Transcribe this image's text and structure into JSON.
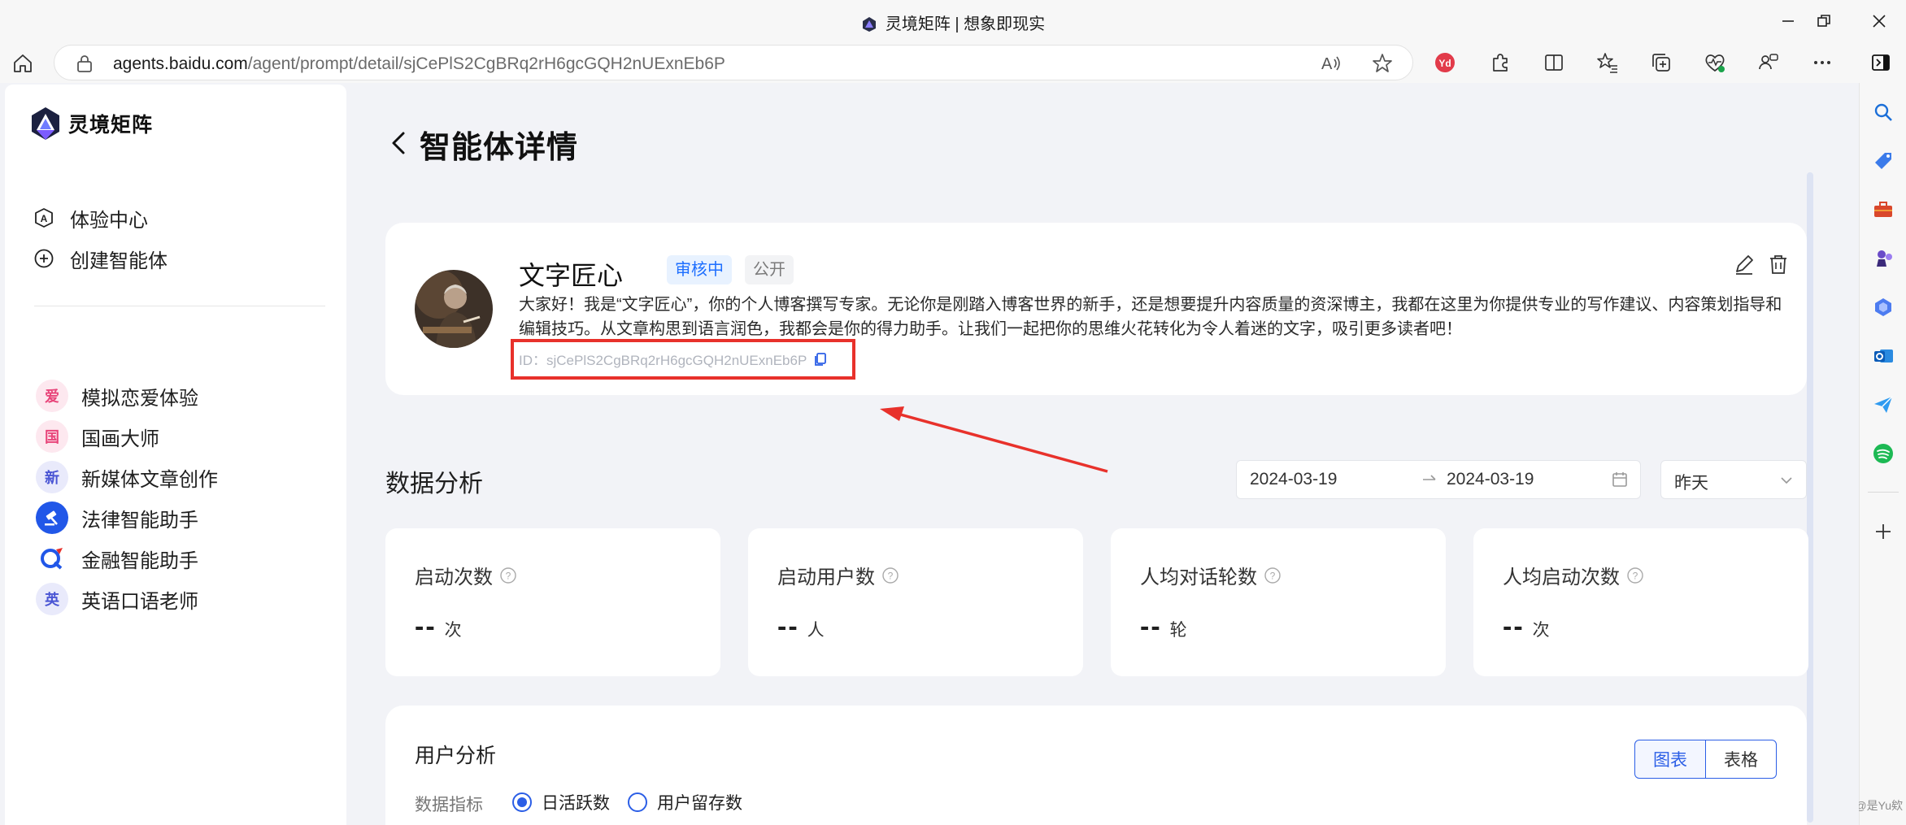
{
  "browser": {
    "window_title": "灵境矩阵 | 想象即现实",
    "url_host": "agents.baidu.com",
    "url_path": "/agent/prompt/detail/sjCePlS2CgBRq2rH6gcGQH2nUExnEb6P"
  },
  "watermark": "CSDN @是Yu欸",
  "sidebar": {
    "brand": "灵境矩阵",
    "nav": [
      {
        "label": "体验中心",
        "icon": "experience-icon"
      },
      {
        "label": "创建智能体",
        "icon": "plus-circle-icon"
      }
    ],
    "agents": [
      {
        "label": "模拟恋爱体验",
        "badge": "爱",
        "color": "#e8457a",
        "bg": "#fde8ef"
      },
      {
        "label": "国画大师",
        "badge": "国",
        "color": "#e8457a",
        "bg": "#fde8ef"
      },
      {
        "label": "新媒体文章创作",
        "badge": "新",
        "color": "#4a55d4",
        "bg": "#e9eafb"
      },
      {
        "label": "法律智能助手",
        "badge": "",
        "color": "#ffffff",
        "bg": "#2157e8"
      },
      {
        "label": "金融智能助手",
        "badge": "",
        "color": "#2157e8",
        "bg": "#ffffff"
      },
      {
        "label": "英语口语老师",
        "badge": "英",
        "color": "#4a55d4",
        "bg": "#e9eafb"
      }
    ]
  },
  "page": {
    "title": "智能体详情"
  },
  "agent": {
    "name": "文字匠心",
    "status_tag": "审核中",
    "visibility_tag": "公开",
    "description": "大家好！我是“文字匠心”，你的个人博客撰写专家。无论你是刚踏入博客世界的新手，还是想要提升内容质量的资深博主，我都在这里为你提供专业的写作建议、内容策划指导和编辑技巧。从文章构思到语言润色，我都会是你的得力助手。让我们一起把你的思维火花转化为令人着迷的文字，吸引更多读者吧！",
    "id_line": "ID：sjCePlS2CgBRq2rH6gcGQH2nUExnEb6P"
  },
  "analytics": {
    "title": "数据分析",
    "date_start": "2024-03-19",
    "date_end": "2024-03-19",
    "period": "昨天",
    "stats": [
      {
        "label": "启动次数",
        "value": "--",
        "unit": "次"
      },
      {
        "label": "启动用户数",
        "value": "--",
        "unit": "人"
      },
      {
        "label": "人均对话轮数",
        "value": "--",
        "unit": "轮"
      },
      {
        "label": "人均启动次数",
        "value": "--",
        "unit": "次"
      }
    ]
  },
  "user_analysis": {
    "title": "用户分析",
    "metric_label": "数据指标",
    "options": [
      {
        "label": "日活跃数",
        "selected": true
      },
      {
        "label": "用户留存数",
        "selected": false
      }
    ],
    "view_tabs": [
      "图表",
      "表格"
    ],
    "active_view": "图表"
  },
  "colors": {
    "accent": "#2b5ee6",
    "annotation_red": "#e8312b",
    "page_bg": "#f2f3f7"
  }
}
